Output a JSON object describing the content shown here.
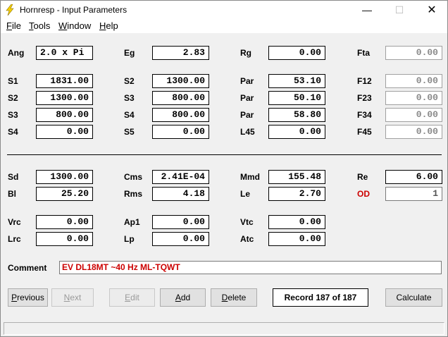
{
  "window": {
    "title": "Hornresp - Input Parameters",
    "controls": {
      "minimize": "—",
      "maximize": "☐",
      "close": "✕"
    }
  },
  "menu": [
    {
      "label": "File",
      "key": "F",
      "rest": "ile"
    },
    {
      "label": "Tools",
      "key": "T",
      "rest": "ools"
    },
    {
      "label": "Window",
      "key": "W",
      "rest": "indow"
    },
    {
      "label": "Help",
      "key": "H",
      "rest": "elp"
    }
  ],
  "params": {
    "ang": {
      "label": "Ang",
      "value": "2.0 x Pi"
    },
    "eg": {
      "label": "Eg",
      "value": "2.83"
    },
    "rg": {
      "label": "Rg",
      "value": "0.00"
    },
    "fta": {
      "label": "Fta",
      "value": "0.00"
    },
    "s1": {
      "label": "S1",
      "value": "1831.00"
    },
    "s2a": {
      "label": "S2",
      "value": "1300.00"
    },
    "par1": {
      "label": "Par",
      "value": "53.10"
    },
    "f12": {
      "label": "F12",
      "value": "0.00"
    },
    "s2b": {
      "label": "S2",
      "value": "1300.00"
    },
    "s3a": {
      "label": "S3",
      "value": "800.00"
    },
    "par2": {
      "label": "Par",
      "value": "50.10"
    },
    "f23": {
      "label": "F23",
      "value": "0.00"
    },
    "s3b": {
      "label": "S3",
      "value": "800.00"
    },
    "s4a": {
      "label": "S4",
      "value": "800.00"
    },
    "par3": {
      "label": "Par",
      "value": "58.80"
    },
    "f34": {
      "label": "F34",
      "value": "0.00"
    },
    "s4b": {
      "label": "S4",
      "value": "0.00"
    },
    "s5": {
      "label": "S5",
      "value": "0.00"
    },
    "l45": {
      "label": "L45",
      "value": "0.00"
    },
    "f45": {
      "label": "F45",
      "value": "0.00"
    },
    "sd": {
      "label": "Sd",
      "value": "1300.00"
    },
    "cms": {
      "label": "Cms",
      "value": "2.41E-04"
    },
    "mmd": {
      "label": "Mmd",
      "value": "155.48"
    },
    "re": {
      "label": "Re",
      "value": "6.00"
    },
    "bl": {
      "label": "Bl",
      "value": "25.20"
    },
    "rms": {
      "label": "Rms",
      "value": "4.18"
    },
    "le": {
      "label": "Le",
      "value": "2.70"
    },
    "od": {
      "label": "OD",
      "value": "1"
    },
    "vrc": {
      "label": "Vrc",
      "value": "0.00"
    },
    "ap1": {
      "label": "Ap1",
      "value": "0.00"
    },
    "vtc": {
      "label": "Vtc",
      "value": "0.00"
    },
    "lrc": {
      "label": "Lrc",
      "value": "0.00"
    },
    "lp": {
      "label": "Lp",
      "value": "0.00"
    },
    "atc": {
      "label": "Atc",
      "value": "0.00"
    }
  },
  "comment": {
    "label": "Comment",
    "value": "EV DL18MT ~40 Hz ML-TQWT"
  },
  "buttons": {
    "previous": {
      "key": "P",
      "rest": "revious"
    },
    "next": {
      "key": "N",
      "rest": "ext"
    },
    "edit": {
      "key": "E",
      "rest": "dit"
    },
    "add": {
      "key": "A",
      "rest": "dd"
    },
    "delete": {
      "key": "D",
      "rest": "elete"
    },
    "calculate": "Calculate"
  },
  "record": "Record 187 of 187",
  "colors": {
    "accent_red": "#cc0000",
    "icon_yellow": "#f5d000"
  }
}
